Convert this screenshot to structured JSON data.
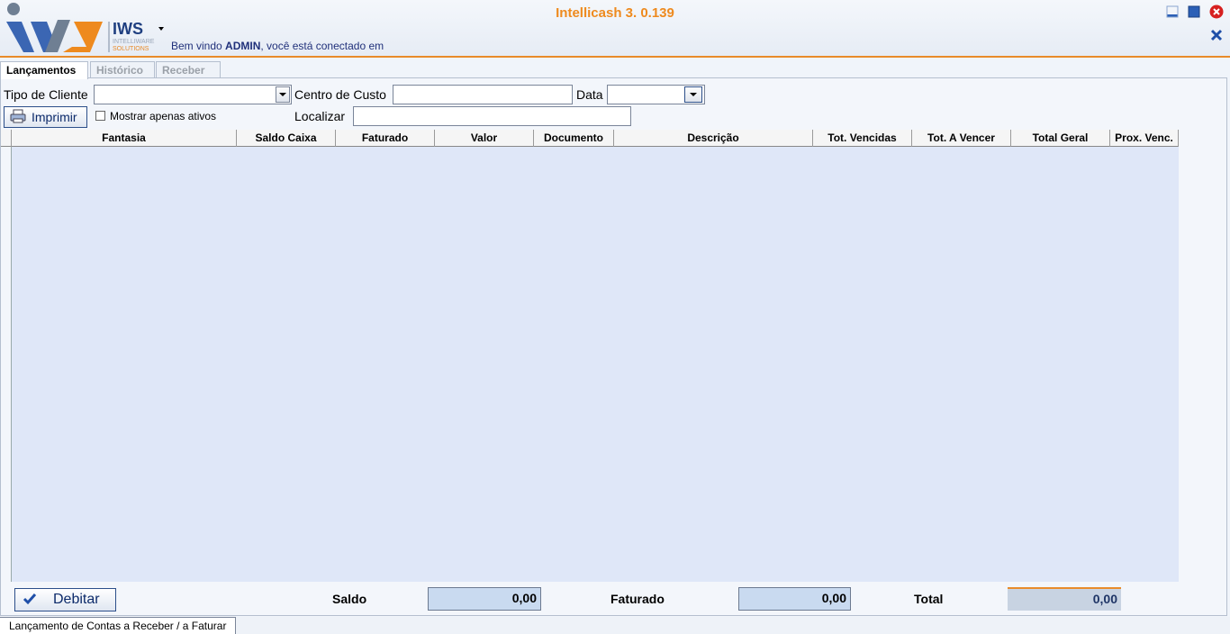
{
  "window": {
    "title": "Intellicash 3. 0.139",
    "welcome_prefix": "Bem vindo",
    "user": "ADMIN",
    "welcome_suffix": ", você está conectado em",
    "logo_text": "IWS",
    "logo_sub1": "INTELLIWARE",
    "logo_sub2": "SOLUTIONS"
  },
  "tabs": [
    {
      "label": "Lançamentos",
      "active": true
    },
    {
      "label": "Histórico",
      "active": false
    },
    {
      "label": "Receber",
      "active": false
    }
  ],
  "filters": {
    "tipo_cliente_label": "Tipo de Cliente",
    "tipo_cliente_value": "",
    "centro_custo_label": "Centro de Custo",
    "centro_custo_value": "",
    "data_label": "Data",
    "data_value": "",
    "imprimir_label": "Imprimir",
    "mostrar_ativos_label": "Mostrar apenas ativos",
    "localizar_label": "Localizar",
    "localizar_value": ""
  },
  "grid": {
    "columns": [
      "Fantasia",
      "Saldo Caixa",
      "Faturado",
      "Valor",
      "Documento",
      "Descrição",
      "Tot. Vencidas",
      "Tot. A Vencer",
      "Total Geral",
      "Prox. Venc."
    ],
    "rows": []
  },
  "footer": {
    "debitar_label": "Debitar",
    "saldo_label": "Saldo",
    "saldo_value": "0,00",
    "faturado_label": "Faturado",
    "faturado_value": "0,00",
    "total_label": "Total",
    "total_value": "0,00"
  },
  "status": {
    "tab_label": "Lançamento de Contas a Receber / a Faturar"
  },
  "colors": {
    "accent": "#ee8a1e",
    "grid_bg": "#dfe7f8",
    "sum_bg": "#c9daf0"
  }
}
